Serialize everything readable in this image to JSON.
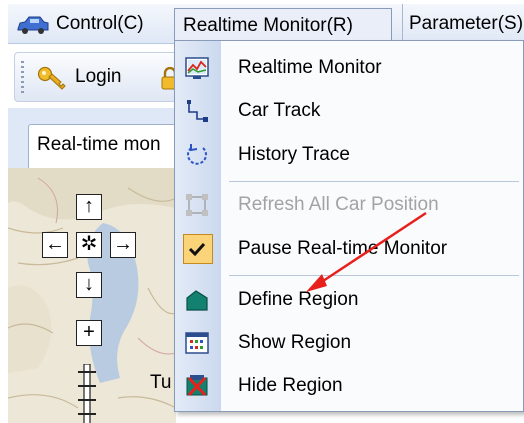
{
  "menubar": {
    "control": "Control(C)",
    "realtime_monitor": "Realtime Monitor(R)",
    "parameter": "Parameter(S)"
  },
  "toolbar": {
    "login_label": "Login"
  },
  "tab": {
    "label": "Real-time mon"
  },
  "map": {
    "label_fragment": "Tu",
    "nav": {
      "up": "↑",
      "left": "←",
      "center": "✲",
      "right": "→",
      "down": "↓",
      "zoom_in": "+"
    }
  },
  "dropdown": {
    "items": [
      {
        "label": "Realtime Monitor",
        "icon": "monitor-chart-icon",
        "enabled": true
      },
      {
        "label": "Car Track",
        "icon": "track-path-icon",
        "enabled": true
      },
      {
        "label": "History Trace",
        "icon": "circular-arrow-icon",
        "enabled": true
      },
      {
        "label": "Refresh All Car Position",
        "icon": "refresh-grid-icon",
        "enabled": false
      },
      {
        "label": "Pause Real-time Monitor",
        "icon": "checkmark-icon",
        "enabled": true,
        "checked": true
      },
      {
        "label": "Define Region",
        "icon": "region-shape-icon",
        "enabled": true
      },
      {
        "label": "Show Region",
        "icon": "show-region-icon",
        "enabled": true
      },
      {
        "label": "Hide Region",
        "icon": "hide-region-icon",
        "enabled": true
      }
    ]
  },
  "colors": {
    "menubar_bg": "#dfe8f6",
    "gutter": "#cbd8ee",
    "checked_bg": "#fbd47a",
    "annotation_arrow": "#e8201c",
    "disabled_text": "#a3a3a3"
  }
}
